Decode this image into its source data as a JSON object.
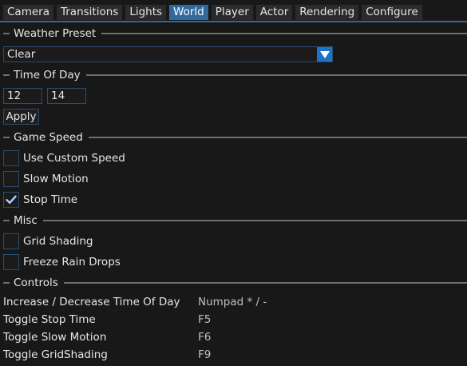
{
  "tabs": [
    "Camera",
    "Transitions",
    "Lights",
    "World",
    "Player",
    "Actor",
    "Rendering",
    "Configure"
  ],
  "active_tab": "World",
  "accent_color": "#2f6a9e",
  "sections": {
    "weather": "Weather Preset",
    "time": "Time Of Day",
    "speed": "Game Speed",
    "misc": "Misc",
    "controls": "Controls"
  },
  "weather_preset": {
    "value": "Clear"
  },
  "time_of_day": {
    "hour": "12",
    "minute": "14",
    "apply_label": "Apply"
  },
  "game_speed": {
    "use_custom_speed": {
      "label": "Use Custom Speed",
      "checked": false
    },
    "slow_motion": {
      "label": "Slow Motion",
      "checked": false
    },
    "stop_time": {
      "label": "Stop Time",
      "checked": true
    }
  },
  "misc": {
    "grid_shading": {
      "label": "Grid Shading",
      "checked": false
    },
    "freeze_rain": {
      "label": "Freeze Rain Drops",
      "checked": false
    }
  },
  "controls": [
    {
      "action": "Increase / Decrease Time Of Day",
      "key": "Numpad * / -"
    },
    {
      "action": "Toggle Stop Time",
      "key": "F5"
    },
    {
      "action": "Toggle Slow Motion",
      "key": "F6"
    },
    {
      "action": "Toggle GridShading",
      "key": "F9"
    }
  ]
}
